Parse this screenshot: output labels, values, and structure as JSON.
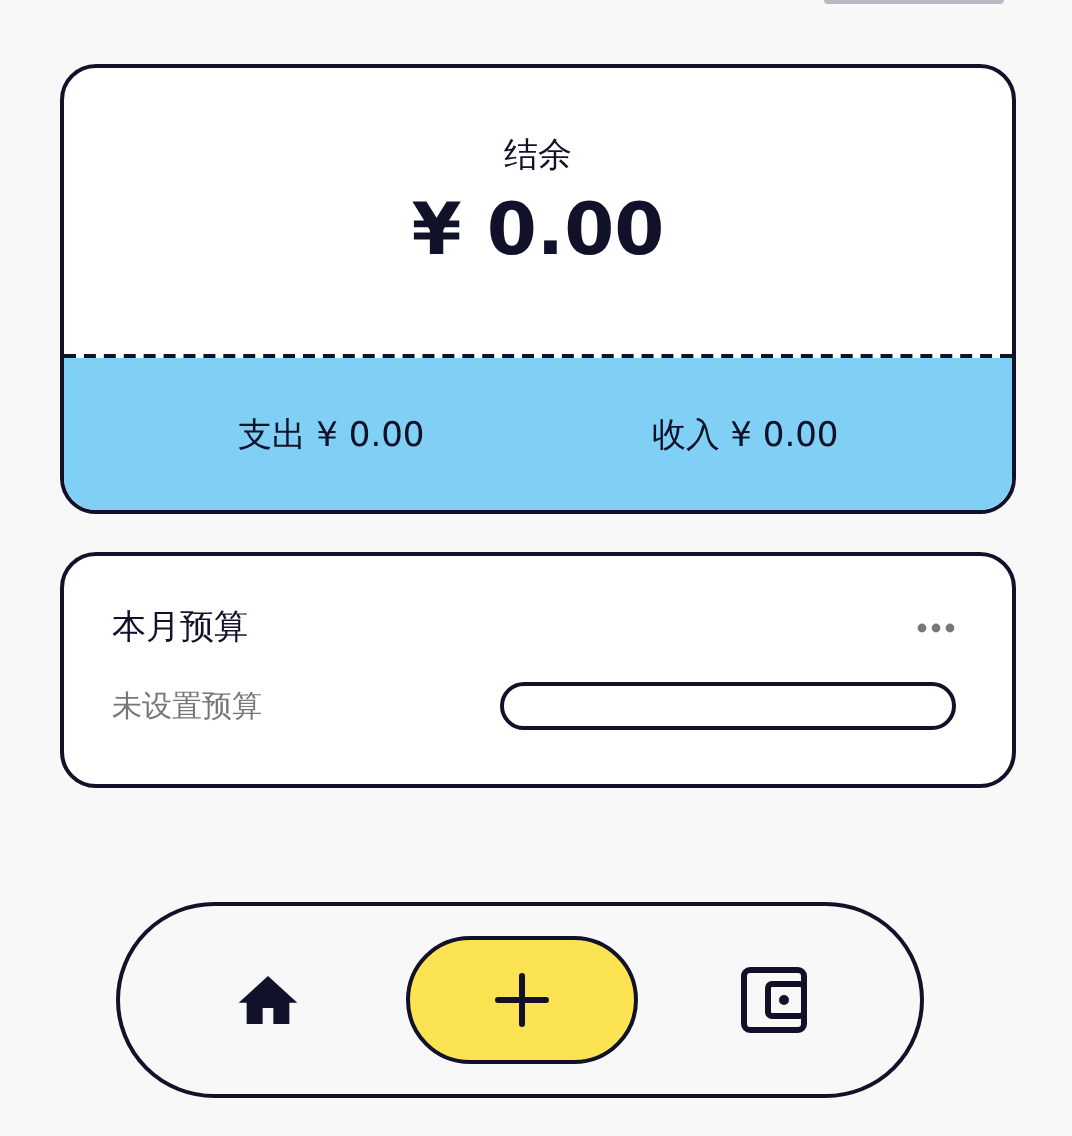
{
  "summary": {
    "balance_label": "结余",
    "balance": "¥ 0.00",
    "expense": "支出 ¥ 0.00",
    "income": "收入 ¥ 0.00"
  },
  "budget": {
    "title": "本月预算",
    "status": "未设置预算",
    "level": 0
  }
}
